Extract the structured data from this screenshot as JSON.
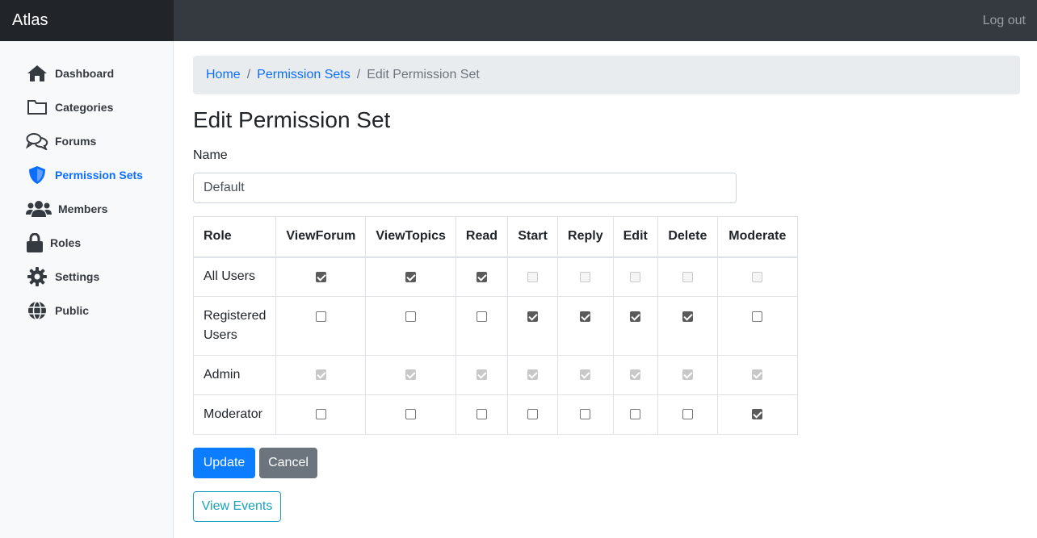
{
  "app": {
    "brand": "Atlas",
    "logout_label": "Log out"
  },
  "sidebar": {
    "items": [
      {
        "label": "Dashboard",
        "icon": "home-icon",
        "active": false
      },
      {
        "label": "Categories",
        "icon": "folder-icon",
        "active": false
      },
      {
        "label": "Forums",
        "icon": "comments-icon",
        "active": false
      },
      {
        "label": "Permission Sets",
        "icon": "shield-icon",
        "active": true
      },
      {
        "label": "Members",
        "icon": "users-icon",
        "active": false
      },
      {
        "label": "Roles",
        "icon": "lock-icon",
        "active": false
      },
      {
        "label": "Settings",
        "icon": "gear-icon",
        "active": false
      },
      {
        "label": "Public",
        "icon": "globe-icon",
        "active": false
      }
    ]
  },
  "breadcrumb": {
    "home": "Home",
    "permission_sets": "Permission Sets",
    "current": "Edit Permission Set",
    "separator": "/"
  },
  "page": {
    "title": "Edit Permission Set"
  },
  "form": {
    "name_label": "Name",
    "name_value": "Default"
  },
  "table": {
    "headers": [
      "Role",
      "ViewForum",
      "ViewTopics",
      "Read",
      "Start",
      "Reply",
      "Edit",
      "Delete",
      "Moderate"
    ],
    "rows": [
      {
        "role": "All Users",
        "checked": [
          true,
          true,
          true,
          false,
          false,
          false,
          false,
          false
        ],
        "disabled": [
          false,
          false,
          false,
          true,
          true,
          true,
          true,
          true
        ]
      },
      {
        "role": "Registered Users",
        "checked": [
          false,
          false,
          false,
          true,
          true,
          true,
          true,
          false
        ],
        "disabled": [
          false,
          false,
          false,
          false,
          false,
          false,
          false,
          false
        ]
      },
      {
        "role": "Admin",
        "checked": [
          true,
          true,
          true,
          true,
          true,
          true,
          true,
          true
        ],
        "disabled": [
          true,
          true,
          true,
          true,
          true,
          true,
          true,
          true
        ]
      },
      {
        "role": "Moderator",
        "checked": [
          false,
          false,
          false,
          false,
          false,
          false,
          false,
          true
        ],
        "disabled": [
          false,
          false,
          false,
          false,
          false,
          false,
          false,
          false
        ]
      }
    ]
  },
  "buttons": {
    "update": "Update",
    "cancel": "Cancel",
    "view_events": "View Events"
  },
  "colors": {
    "primary": "#0d7dff",
    "secondary": "#6c757d",
    "info": "#17a2b8",
    "navbar": "#343a40",
    "brand_bg": "#212529"
  }
}
